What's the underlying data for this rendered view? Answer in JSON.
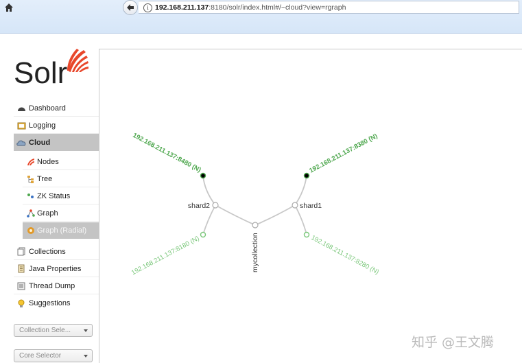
{
  "browser": {
    "url_host": "192.168.211.137",
    "url_rest": ":8180/solr/index.html#/~cloud?view=rgraph"
  },
  "logo": {
    "text": "Solr"
  },
  "nav": {
    "dashboard": "Dashboard",
    "logging": "Logging",
    "cloud": "Cloud",
    "nodes": "Nodes",
    "tree": "Tree",
    "zk_status": "ZK Status",
    "graph": "Graph",
    "graph_radial": "Graph (Radial)",
    "collections": "Collections",
    "java_properties": "Java Properties",
    "thread_dump": "Thread Dump",
    "suggestions": "Suggestions"
  },
  "selectors": {
    "collection": "Collection Sele...",
    "core": "Core Selector"
  },
  "graph": {
    "collection": "mycollection",
    "shards": [
      {
        "name": "shard1",
        "replicas": [
          {
            "address": "192.168.211.137:8380 (N)",
            "leader": true
          },
          {
            "address": "192.168.211.137:8280 (N)",
            "leader": false
          }
        ]
      },
      {
        "name": "shard2",
        "replicas": [
          {
            "address": "192.168.211.137:8480 (N)",
            "leader": true
          },
          {
            "address": "192.168.211.137:8180 (N)",
            "leader": false
          }
        ]
      }
    ],
    "colors": {
      "active_leader": "#4ea74e",
      "active": "#7ac77a",
      "edge": "#c8c8c8"
    }
  },
  "watermark": "知乎 @王文腾"
}
